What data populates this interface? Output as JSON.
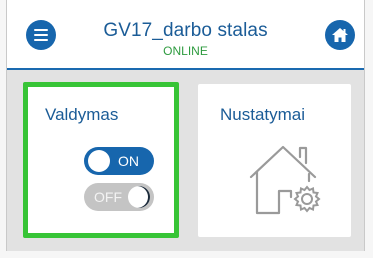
{
  "header": {
    "title": "GV17_darbo stalas",
    "status": "ONLINE"
  },
  "tiles": [
    {
      "label": "Valdymas",
      "toggles": [
        {
          "label": "ON",
          "state": "on"
        },
        {
          "label": "OFF",
          "state": "off"
        }
      ]
    },
    {
      "label": "Nustatymai",
      "icon": "house-gear-icon"
    }
  ],
  "colors": {
    "primary": "#1766ad",
    "status": "#2e9b3f",
    "active_border": "#37c436"
  }
}
